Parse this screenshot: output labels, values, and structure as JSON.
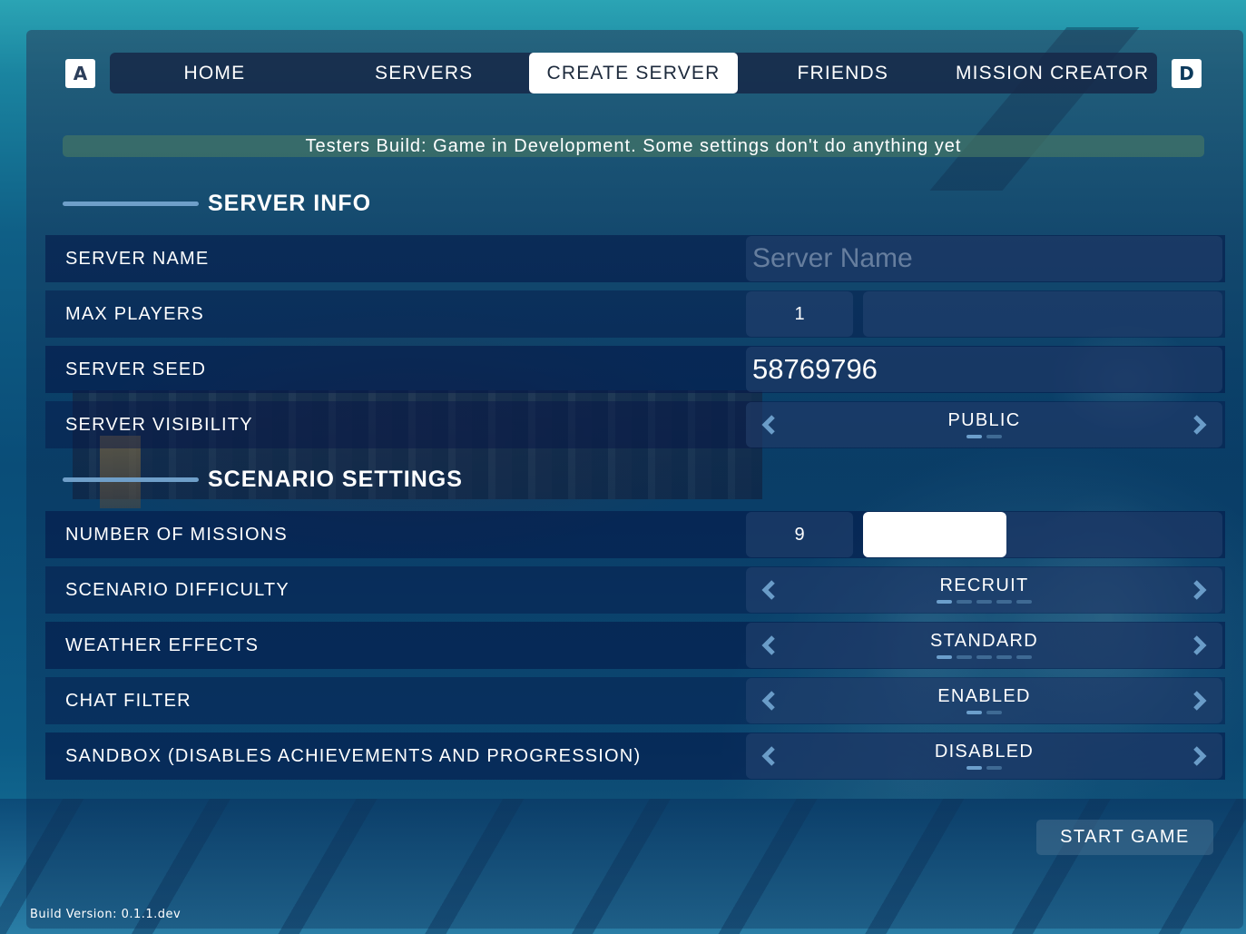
{
  "nav": {
    "left_key": "A",
    "right_key": "D",
    "tabs": [
      {
        "label": "HOME",
        "active": false
      },
      {
        "label": "SERVERS",
        "active": false
      },
      {
        "label": "CREATE SERVER",
        "active": true
      },
      {
        "label": "FRIENDS",
        "active": false
      },
      {
        "label": "MISSION CREATOR",
        "active": false
      }
    ]
  },
  "notice": "Testers Build: Game in Development. Some settings don't do anything yet",
  "sections": {
    "server_info": "SERVER INFO",
    "scenario_settings": "SCENARIO SETTINGS"
  },
  "server_info": {
    "server_name": {
      "label": "SERVER NAME",
      "value": "",
      "placeholder": "Server Name"
    },
    "max_players": {
      "label": "MAX PLAYERS",
      "value": "1",
      "slider_fraction": 0.0
    },
    "server_seed": {
      "label": "SERVER SEED",
      "value": "58769796"
    },
    "server_visibility": {
      "label": "SERVER VISIBILITY",
      "value": "PUBLIC",
      "option_count": 2,
      "selected_index": 0
    }
  },
  "scenario": {
    "number_of_missions": {
      "label": "NUMBER OF MISSIONS",
      "value": "9",
      "slider_fraction": 0.4
    },
    "scenario_difficulty": {
      "label": "SCENARIO DIFFICULTY",
      "value": "RECRUIT",
      "option_count": 5,
      "selected_index": 0
    },
    "weather_effects": {
      "label": "WEATHER EFFECTS",
      "value": "STANDARD",
      "option_count": 5,
      "selected_index": 0
    },
    "chat_filter": {
      "label": "CHAT FILTER",
      "value": "ENABLED",
      "option_count": 2,
      "selected_index": 0
    },
    "sandbox": {
      "label": "SANDBOX (DISABLES ACHIEVEMENTS AND PROGRESSION)",
      "value": "DISABLED",
      "option_count": 2,
      "selected_index": 0
    }
  },
  "start_button": "START GAME",
  "build_version": "Build Version: 0.1.1.dev",
  "colors": {
    "accent": "#6c9fcc",
    "nav_bg": "#16284a",
    "notice_bg": "#467864"
  }
}
